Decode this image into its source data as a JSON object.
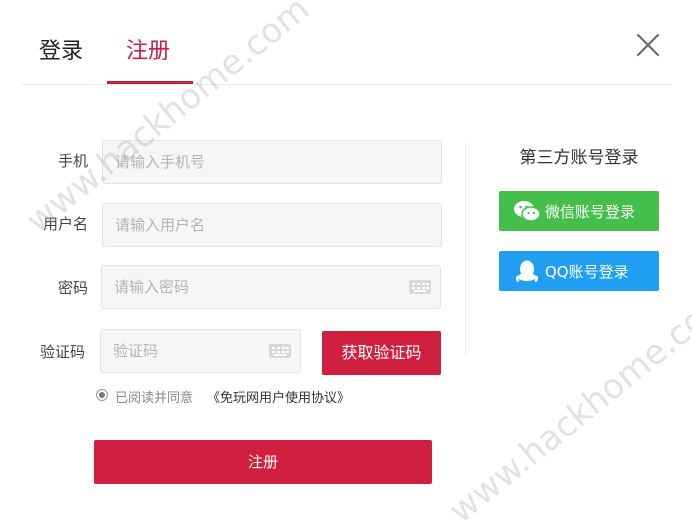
{
  "tabs": {
    "login": "登录",
    "register": "注册"
  },
  "form": {
    "phone": {
      "label": "手机",
      "placeholder": "请输入手机号"
    },
    "username": {
      "label": "用户名",
      "placeholder": "请输入用户名"
    },
    "password": {
      "label": "密码",
      "placeholder": "请输入密码"
    },
    "code": {
      "label": "验证码",
      "placeholder": "验证码"
    },
    "get_code_button": "获取验证码",
    "agreement_prefix": "已阅读并同意",
    "agreement_link": "《免玩网用户使用协议》",
    "submit_button": "注册"
  },
  "third_party": {
    "title": "第三方账号登录",
    "wechat_button": "微信账号登录",
    "qq_button": "QQ账号登录"
  },
  "watermark": "www.hackhome.com",
  "colors": {
    "accent": "#d1203f",
    "wechat": "#44bf4c",
    "qq": "#1f9ef2"
  }
}
